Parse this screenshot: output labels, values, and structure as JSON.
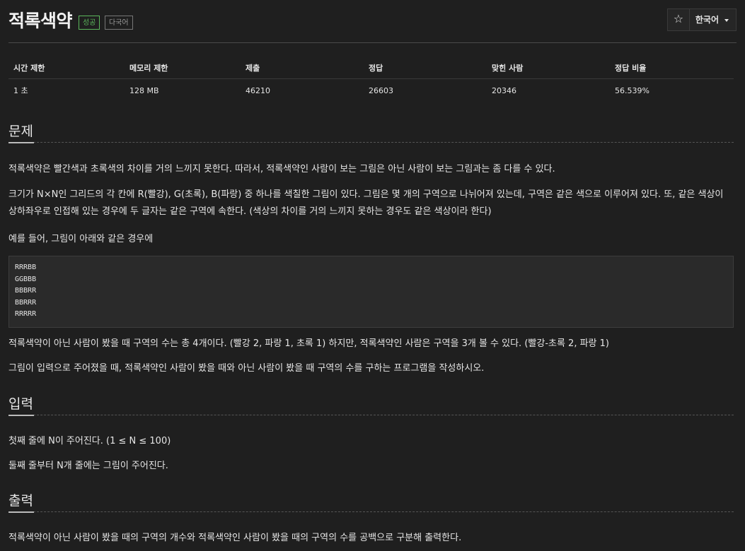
{
  "problem": {
    "title": "적록색약",
    "badges": {
      "success": "성공",
      "multilang": "다국어"
    }
  },
  "header": {
    "star_icon": "star-icon",
    "language": "한국어"
  },
  "stats": {
    "headers": [
      "시간 제한",
      "메모리 제한",
      "제출",
      "정답",
      "맞힌 사람",
      "정답 비율"
    ],
    "values": [
      "1 초",
      "128 MB",
      "46210",
      "26603",
      "20346",
      "56.539%"
    ]
  },
  "sections": {
    "problem": {
      "heading": "문제",
      "p1": "적록색약은 빨간색과 초록색의 차이를 거의 느끼지 못한다. 따라서, 적록색약인 사람이 보는 그림은 아닌 사람이 보는 그림과는 좀 다를 수 있다.",
      "p2": "크기가 N×N인 그리드의 각 칸에 R(빨강), G(초록), B(파랑) 중 하나를 색칠한 그림이 있다. 그림은 몇 개의 구역으로 나뉘어져 있는데, 구역은 같은 색으로 이루어져 있다. 또, 같은 색상이 상하좌우로 인접해 있는 경우에 두 글자는 같은 구역에 속한다. (색상의 차이를 거의 느끼지 못하는 경우도 같은 색상이라 한다)",
      "p3": "예를 들어, 그림이 아래와 같은 경우에",
      "sample": "RRRBB\nGGBBB\nBBBRR\nBBRRR\nRRRRR",
      "p4": "적록색약이 아닌 사람이 봤을 때 구역의 수는 총 4개이다. (빨강 2, 파랑 1, 초록 1) 하지만, 적록색약인 사람은 구역을 3개 볼 수 있다. (빨강-초록 2, 파랑 1)",
      "p5": "그림이 입력으로 주어졌을 때, 적록색약인 사람이 봤을 때와 아닌 사람이 봤을 때 구역의 수를 구하는 프로그램을 작성하시오."
    },
    "input": {
      "heading": "입력",
      "p1": "첫째 줄에 N이 주어진다. (1 ≤ N ≤ 100)",
      "p2": "둘째 줄부터 N개 줄에는 그림이 주어진다."
    },
    "output": {
      "heading": "출력",
      "p1": "적록색약이 아닌 사람이 봤을 때의 구역의 개수와 적록색약인 사람이 봤을 때의 구역의 수를 공백으로 구분해 출력한다."
    }
  },
  "colors": {
    "background": "#1f1f1f",
    "success": "#5cb85c",
    "text": "#e6e6e6"
  }
}
